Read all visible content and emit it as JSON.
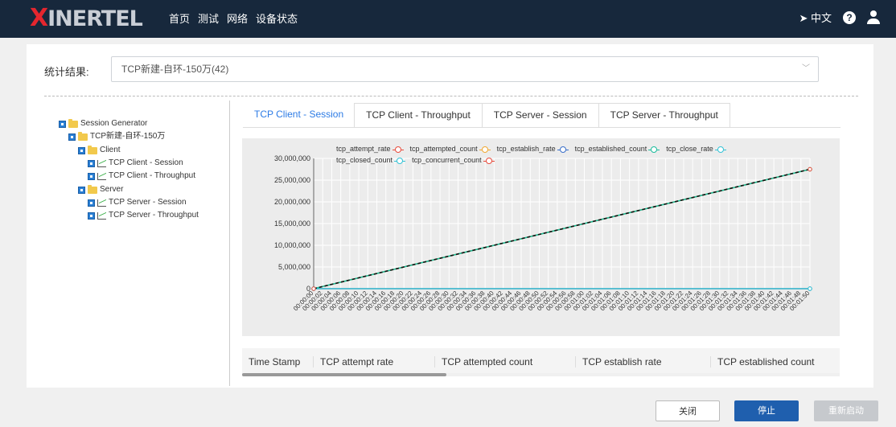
{
  "brand": {
    "logo_x": "X",
    "logo_rest": "INERTEL"
  },
  "nav": [
    "首页",
    "测试",
    "网络",
    "设备状态"
  ],
  "topright": {
    "lang": "中文",
    "help": "?"
  },
  "stats": {
    "label": "统计结果:",
    "selected": "TCP新建-自环-150万(42)"
  },
  "tree": {
    "items": [
      {
        "label": "Session Generator",
        "kind": "folder",
        "level": 0
      },
      {
        "label": "TCP新建-自环-150万",
        "kind": "folder",
        "level": 1
      },
      {
        "label": "Client",
        "kind": "folder",
        "level": 2
      },
      {
        "label": "TCP Client - Session",
        "kind": "chart",
        "level": 3
      },
      {
        "label": "TCP Client - Throughput",
        "kind": "chart",
        "level": 3
      },
      {
        "label": "Server",
        "kind": "folder",
        "level": 2
      },
      {
        "label": "TCP Server - Session",
        "kind": "chart",
        "level": 3
      },
      {
        "label": "TCP Server - Throughput",
        "kind": "chart",
        "level": 3
      }
    ]
  },
  "tabs": [
    {
      "label": "TCP Client - Session",
      "active": true
    },
    {
      "label": "TCP Client - Throughput",
      "active": false
    },
    {
      "label": "TCP Server - Session",
      "active": false
    },
    {
      "label": "TCP Server - Throughput",
      "active": false
    }
  ],
  "chart_data": {
    "type": "line",
    "grid": true,
    "legend_position": "top",
    "ylim": [
      0,
      30000000
    ],
    "yticks": [
      "0",
      "5,000,000",
      "10,000,000",
      "15,000,000",
      "20,000,000",
      "25,000,000",
      "30,000,000"
    ],
    "x_start": "00:00:00",
    "x_end": "00:01:50",
    "x_step_seconds": 2,
    "series": [
      {
        "name": "tcp_attempt_rate",
        "color": "#e84c3d",
        "values": [
          0,
          0
        ]
      },
      {
        "name": "tcp_attempted_count",
        "color": "#f0a830",
        "values": [
          0,
          27500000
        ]
      },
      {
        "name": "tcp_establish_rate",
        "color": "#3a6fc9",
        "values": [
          0,
          0
        ]
      },
      {
        "name": "tcp_established_count",
        "color": "#1abc9c",
        "values": [
          0,
          27500000
        ]
      },
      {
        "name": "tcp_close_rate",
        "color": "#33c3d6",
        "values": [
          0,
          0
        ]
      },
      {
        "name": "tcp_closed_count",
        "color": "#33c3d6",
        "values": [
          0,
          0
        ]
      },
      {
        "name": "tcp_concurrent_count",
        "color": "#e84c3d",
        "values": [
          0,
          27500000
        ]
      }
    ]
  },
  "table": {
    "headers": [
      "Time Stamp",
      "TCP attempt rate",
      "TCP attempted count",
      "TCP establish rate",
      "TCP established count"
    ]
  },
  "buttons": {
    "close": "关闭",
    "stop": "停止",
    "restart": "重新启动"
  }
}
